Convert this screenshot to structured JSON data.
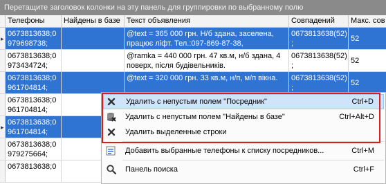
{
  "group_panel": {
    "text": "Перетащите заголовок колонки на эту панель для группировки по выбранному полю"
  },
  "columns": [
    "Телефоны",
    "Найдены в базе",
    "Текст объявления",
    "Совпадений",
    "Макс. сов"
  ],
  "rows": [
    {
      "phones": "0673813638;0\n979698738;",
      "found": "",
      "text": "@text = 365 000 грн. Н/б здана, заселена,\nпрацює ліфт. Тел.:097-869-87-38,",
      "matches": "0673813638(52)\n;",
      "max": "52",
      "selected": true,
      "indicator": "▸"
    },
    {
      "phones": "0673813638;0\n973434724;",
      "found": "",
      "text": "@ramka = 440 000 грн. 47 кв.м, н/б здана, 4\nповерх, після будівельників.",
      "matches": "0673813638(52)\n;",
      "max": "52",
      "selected": false,
      "indicator": ""
    },
    {
      "phones": "0673813638;0\n961704814;",
      "found": "",
      "text": "@text = 320 000 грн. 33 кв.м, н/п, м/п вікна.",
      "matches": "0673813638(52)\n;",
      "max": "52",
      "selected": true,
      "indicator": ""
    },
    {
      "phones": "0673813638;0\n961704814;",
      "found": "",
      "text": "",
      "matches": "",
      "max": "",
      "selected": false,
      "indicator": ""
    },
    {
      "phones": "0673813638;0\n961704814;",
      "found": "",
      "text": "",
      "matches": "",
      "max": "",
      "selected": true,
      "indicator": "▸"
    },
    {
      "phones": "0673813638;0\n979275664;",
      "found": "",
      "text": "",
      "matches": "",
      "max": "",
      "selected": false,
      "indicator": ""
    },
    {
      "phones": "0673813638;0",
      "found": "",
      "text": "",
      "matches": "",
      "max": "",
      "selected": false,
      "indicator": ""
    }
  ],
  "context_menu": {
    "items": [
      {
        "icon": "close-x-icon",
        "label": "Удалить с непустым полем \"Посредник\"",
        "shortcut": "Ctrl+D"
      },
      {
        "icon": "database-delete-icon",
        "label": "Удалить с непустым полем \"Найдены в базе\"",
        "shortcut": "Ctrl+Alt+D"
      },
      {
        "icon": "close-x-icon",
        "label": "Удалить выделенные строки",
        "shortcut": ""
      },
      {
        "icon": "add-list-icon",
        "label": "Добавить выбранные телефоны к списку посредников...",
        "shortcut": "Ctrl+M"
      },
      {
        "icon": "search-icon",
        "label": "Панель поиска",
        "shortcut": "Ctrl+F"
      }
    ]
  },
  "colors": {
    "selection": "#2f73d3",
    "highlight": "#cfe3f9",
    "annotation": "#e11a1a"
  }
}
